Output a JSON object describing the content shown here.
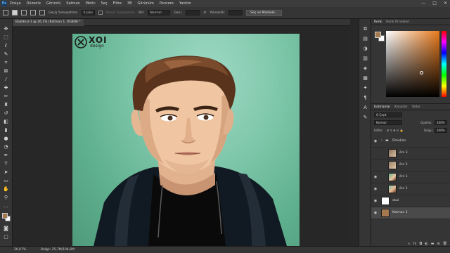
{
  "menubar": {
    "app_icon": "Ps",
    "items": [
      "Dosya",
      "Düzenle",
      "Görüntü",
      "Katman",
      "Metin",
      "Seç",
      "Filtre",
      "3B",
      "Görünüm",
      "Pencere",
      "Yardım"
    ],
    "window_controls": [
      "—",
      "□",
      "✕"
    ]
  },
  "options": {
    "feather_label": "Geçiş Yumuşatma:",
    "feather_value": "0 piks",
    "antialias_label": "Kenar Yumuşatma",
    "style_label": "Stil:",
    "style_value": "Normal",
    "width_label": "Gen.:",
    "height_label": "Yükseklik:",
    "select_mask_button": "Seç ve Maskele..."
  },
  "document": {
    "tab_title": "Başlıksız-1 @ 26,1% (Katman 1, RGB/8) *",
    "logo_text": "XOI",
    "logo_subtext": "design"
  },
  "status": {
    "zoom": "26,07%",
    "doc_info": "Belge: 25,7M/104,8M"
  },
  "color_panel": {
    "tabs": [
      "Renk",
      "Renk Örnekleri"
    ],
    "foreground": "#a4794f",
    "background": "#ffffff"
  },
  "layers_panel": {
    "tabs": [
      "Katmanlar",
      "Kanallar",
      "Yollar"
    ],
    "filter_label": "Q Çeşit",
    "blend_mode": "Normal",
    "opacity_label": "Opaklık:",
    "opacity_value": "100%",
    "lock_label": "Kilitle:",
    "fill_label": "Dolgu:",
    "fill_value": "100%",
    "layers": [
      {
        "name": "Örnekler",
        "type": "group"
      },
      {
        "name": "örn 3"
      },
      {
        "name": "örn 2"
      },
      {
        "name": "örn 1"
      },
      {
        "name": "örn 1"
      },
      {
        "name": "okul"
      },
      {
        "name": "Katman 1"
      }
    ]
  }
}
